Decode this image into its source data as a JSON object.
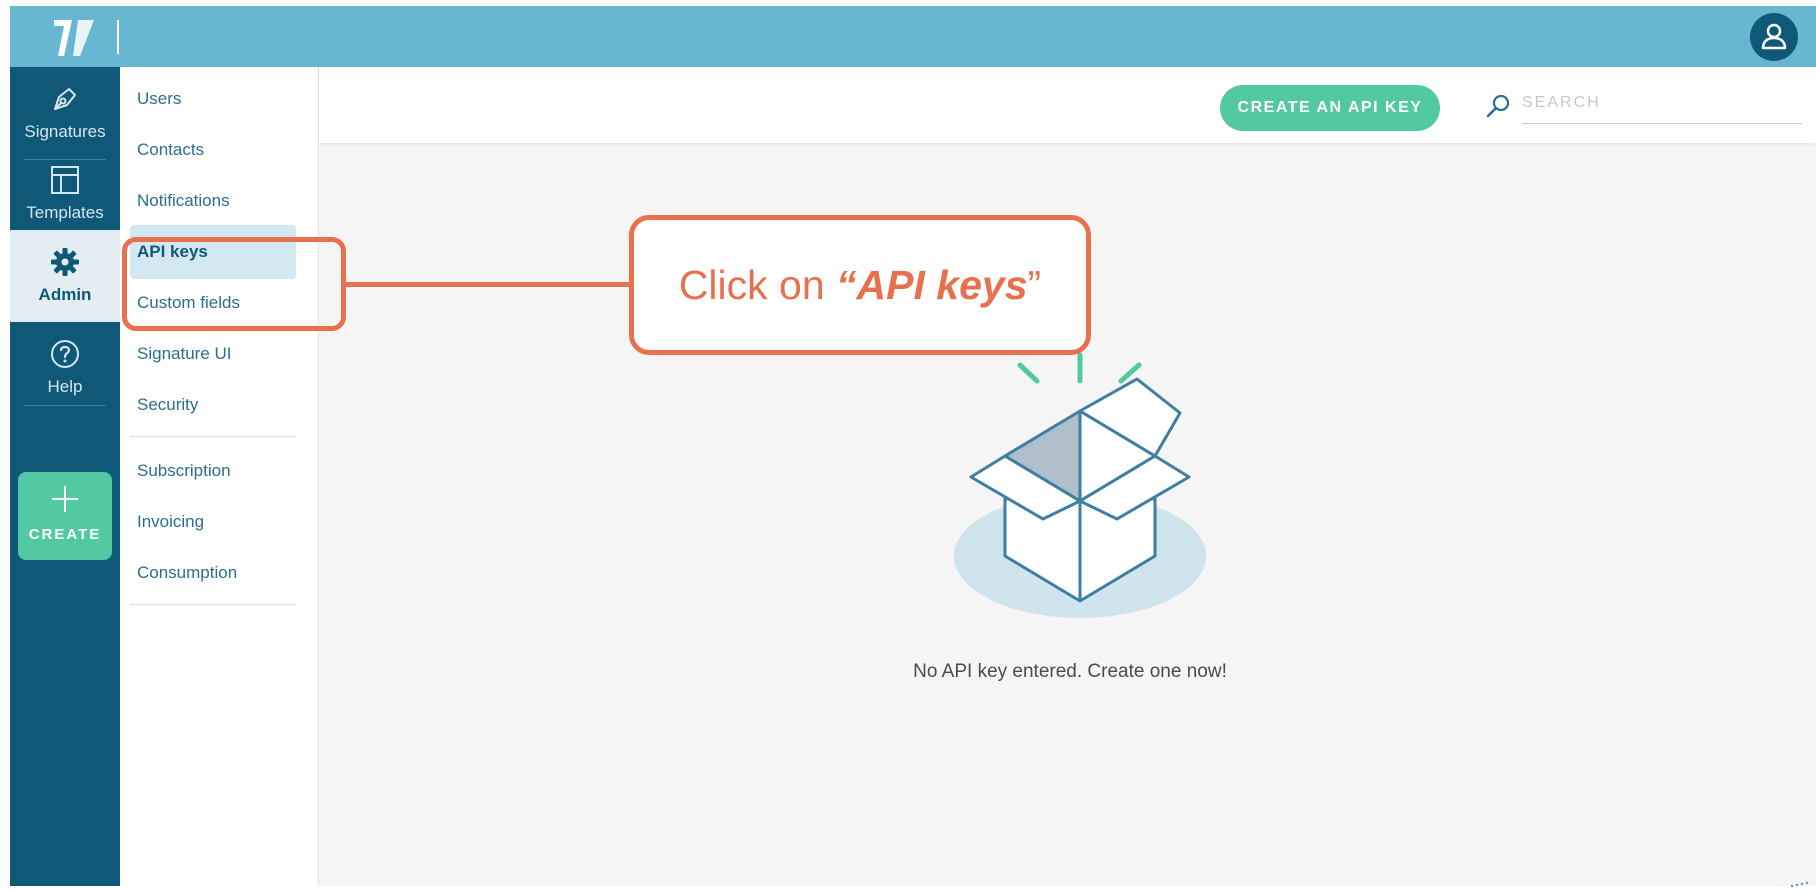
{
  "rail": {
    "items": [
      {
        "label": "Signatures",
        "icon": "pen-nib-icon"
      },
      {
        "label": "Templates",
        "icon": "layout-icon"
      },
      {
        "label": "Admin",
        "icon": "gear-icon",
        "active": true
      },
      {
        "label": "Help",
        "icon": "help-circle-icon"
      }
    ],
    "create_label": "CREATE"
  },
  "subnav": {
    "items": [
      {
        "label": "Users"
      },
      {
        "label": "Contacts"
      },
      {
        "label": "Notifications"
      },
      {
        "label": "API keys",
        "active": true
      },
      {
        "label": "Custom fields"
      },
      {
        "label": "Signature UI"
      },
      {
        "label": "Security"
      },
      {
        "label": "Subscription"
      },
      {
        "label": "Invoicing"
      },
      {
        "label": "Consumption"
      }
    ]
  },
  "header": {
    "create_button_label": "CREATE AN API KEY",
    "search_placeholder": "SEARCH"
  },
  "empty_state": {
    "message": "No API key entered. Create one now!"
  },
  "callout": {
    "prefix": "Click on ",
    "open_quote": "“",
    "target": "API keys",
    "close_quote": "”"
  },
  "colors": {
    "topbar": "#67b6d2",
    "rail": "#0f5878",
    "accent_green": "#52c9a0",
    "annotation": "#e8704f"
  }
}
